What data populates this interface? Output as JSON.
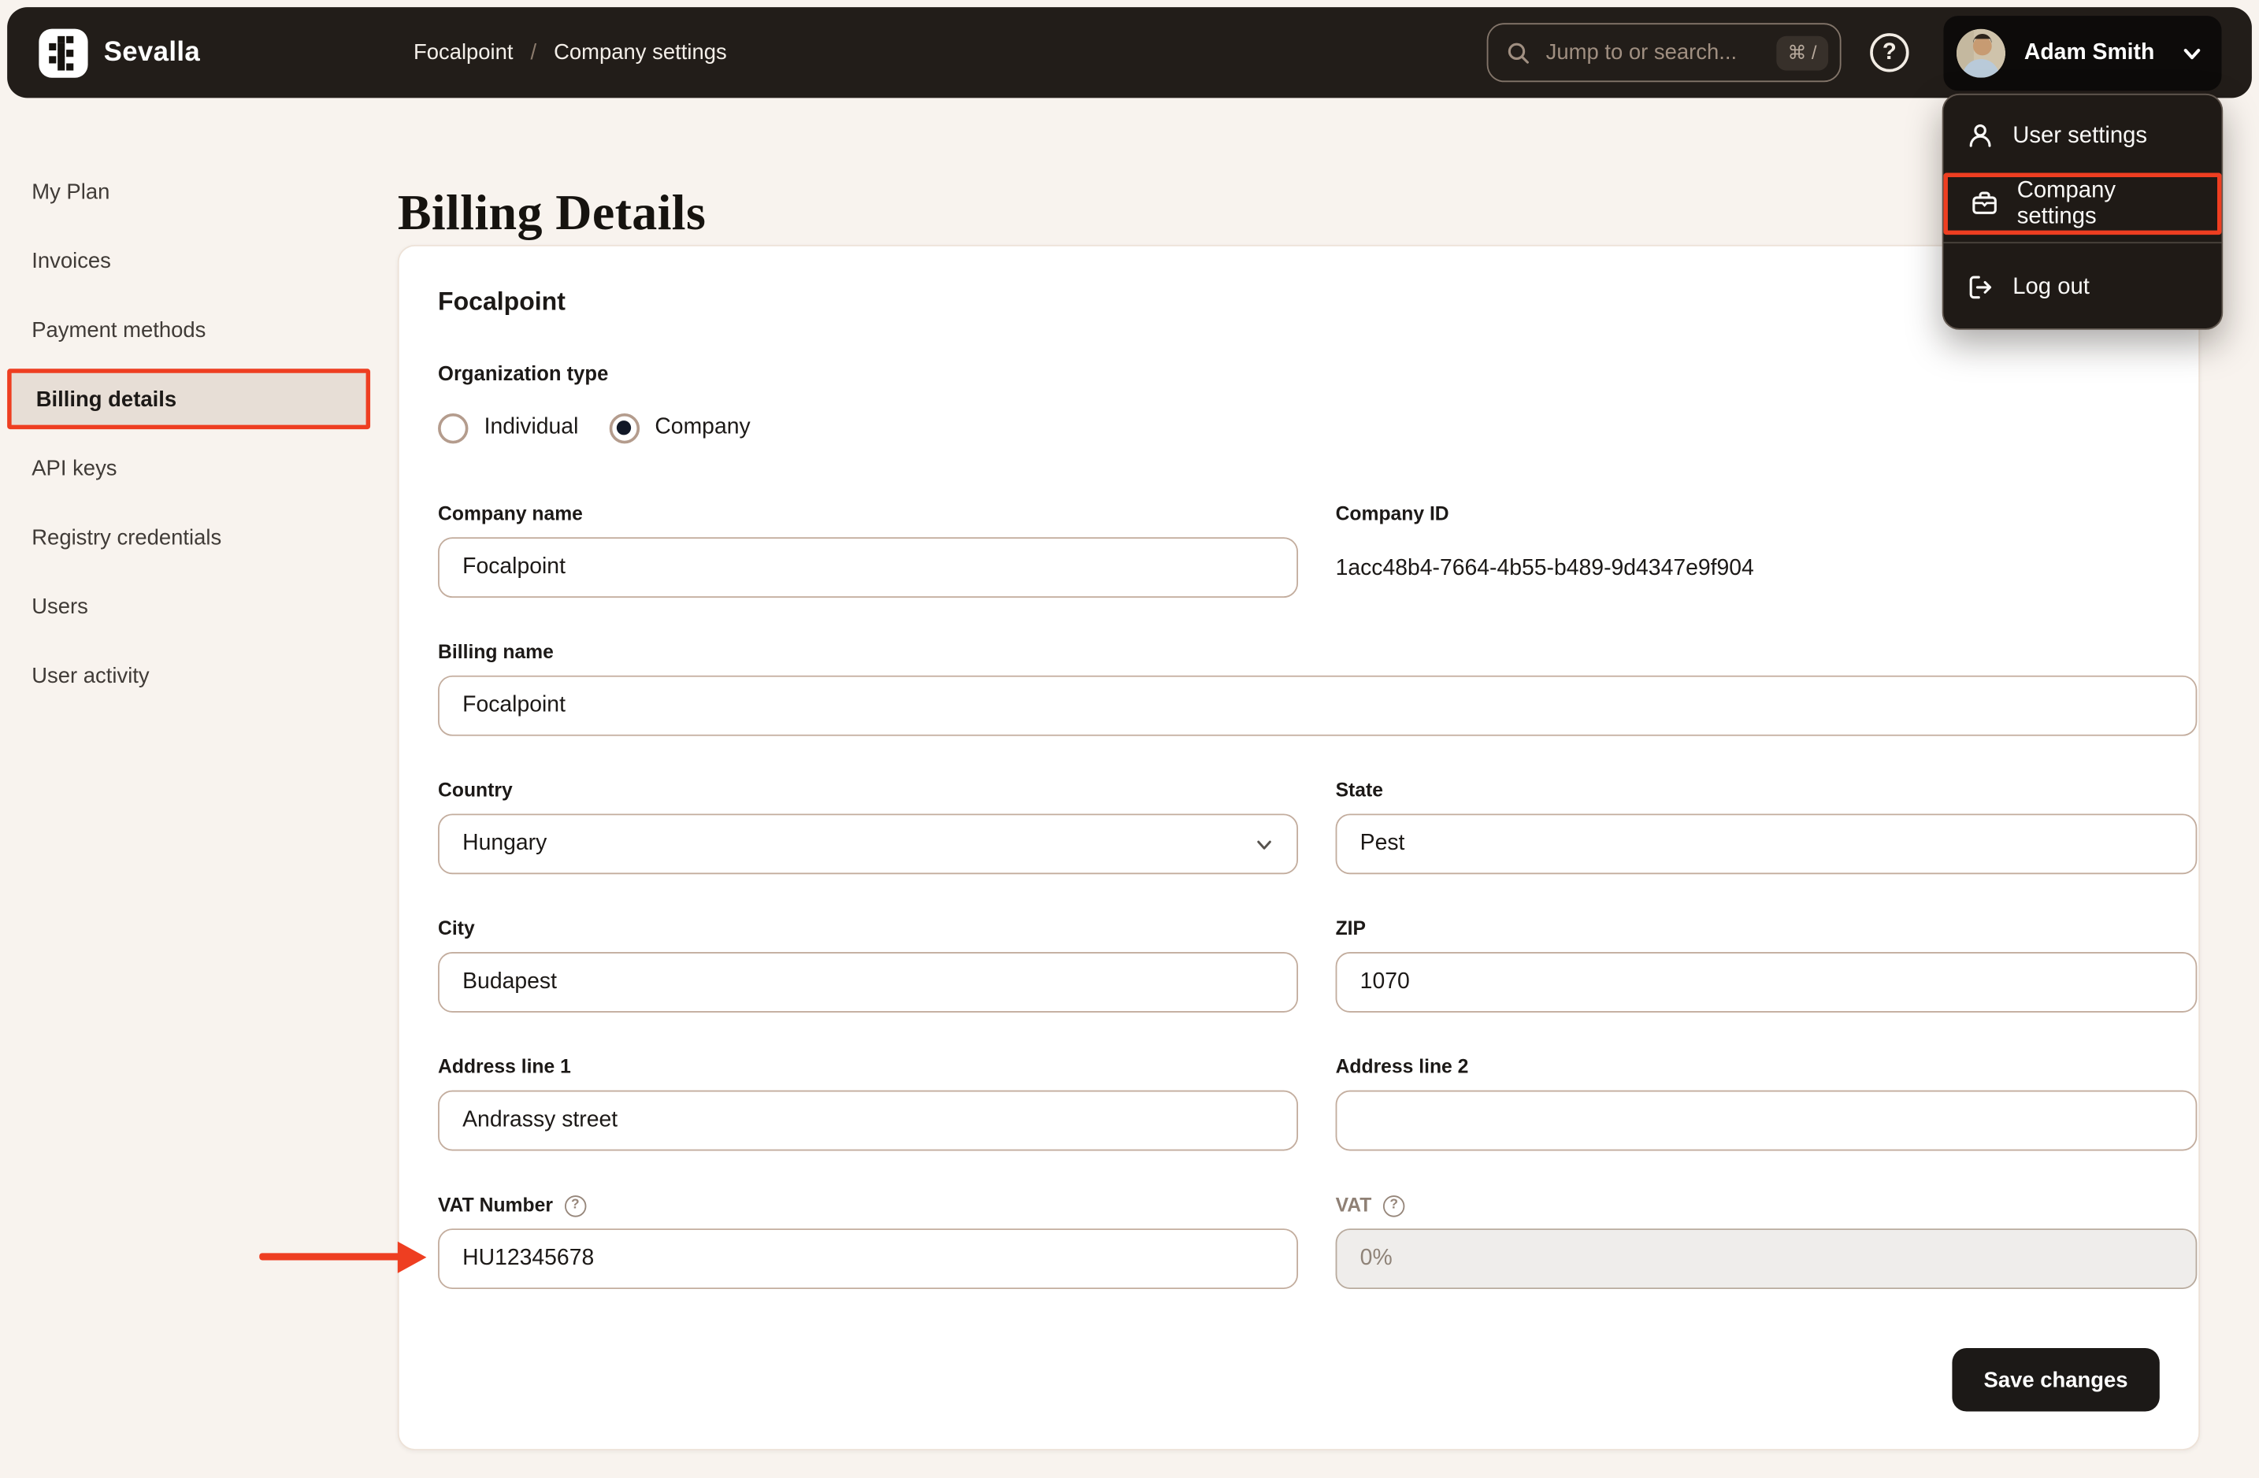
{
  "topbar": {
    "brand": "Sevalla",
    "breadcrumb": {
      "project": "Focalpoint",
      "separator": "/",
      "page": "Company settings"
    },
    "search": {
      "placeholder": "Jump to or search...",
      "shortcut": "⌘ /"
    },
    "user": {
      "name": "Adam Smith"
    }
  },
  "user_menu": {
    "items": [
      {
        "label": "User settings"
      },
      {
        "label": "Company settings"
      },
      {
        "label": "Log out"
      }
    ]
  },
  "sidebar": {
    "items": [
      {
        "label": "My Plan"
      },
      {
        "label": "Invoices"
      },
      {
        "label": "Payment methods"
      },
      {
        "label": "Billing details"
      },
      {
        "label": "API keys"
      },
      {
        "label": "Registry credentials"
      },
      {
        "label": "Users"
      },
      {
        "label": "User activity"
      }
    ]
  },
  "page": {
    "title": "Billing Details"
  },
  "card": {
    "title": "Focalpoint",
    "organization_type": {
      "label": "Organization type",
      "options": [
        {
          "label": "Individual",
          "selected": false
        },
        {
          "label": "Company",
          "selected": true
        }
      ]
    },
    "fields": {
      "company_name": {
        "label": "Company name",
        "value": "Focalpoint"
      },
      "company_id": {
        "label": "Company ID",
        "value": "1acc48b4-7664-4b55-b489-9d4347e9f904"
      },
      "billing_name": {
        "label": "Billing name",
        "value": "Focalpoint"
      },
      "country": {
        "label": "Country",
        "value": "Hungary"
      },
      "state": {
        "label": "State",
        "value": "Pest"
      },
      "city": {
        "label": "City",
        "value": "Budapest"
      },
      "zip": {
        "label": "ZIP",
        "value": "1070"
      },
      "address1": {
        "label": "Address line 1",
        "value": "Andrassy street"
      },
      "address2": {
        "label": "Address line 2",
        "value": ""
      },
      "vat_number": {
        "label": "VAT Number",
        "value": "HU12345678"
      },
      "vat": {
        "label": "VAT",
        "value": "0%"
      }
    },
    "save_button": "Save changes"
  },
  "icons": {
    "help_q": "?",
    "sevalla-logo": "pixel-s",
    "search-icon": "magnifier",
    "chevron-down-icon": "chevron",
    "user-icon": "person",
    "briefcase-icon": "briefcase",
    "logout-icon": "arrow-exit",
    "question-circle-icon": "?"
  },
  "colors": {
    "accent_red": "#ee3e21",
    "topbar_bg": "#221d19",
    "page_bg": "#f8f3ee",
    "card_bg": "#ffffff",
    "active_item_bg": "#e7ded6",
    "input_border": "#c3ad9e",
    "dark_button": "#1c1917"
  }
}
